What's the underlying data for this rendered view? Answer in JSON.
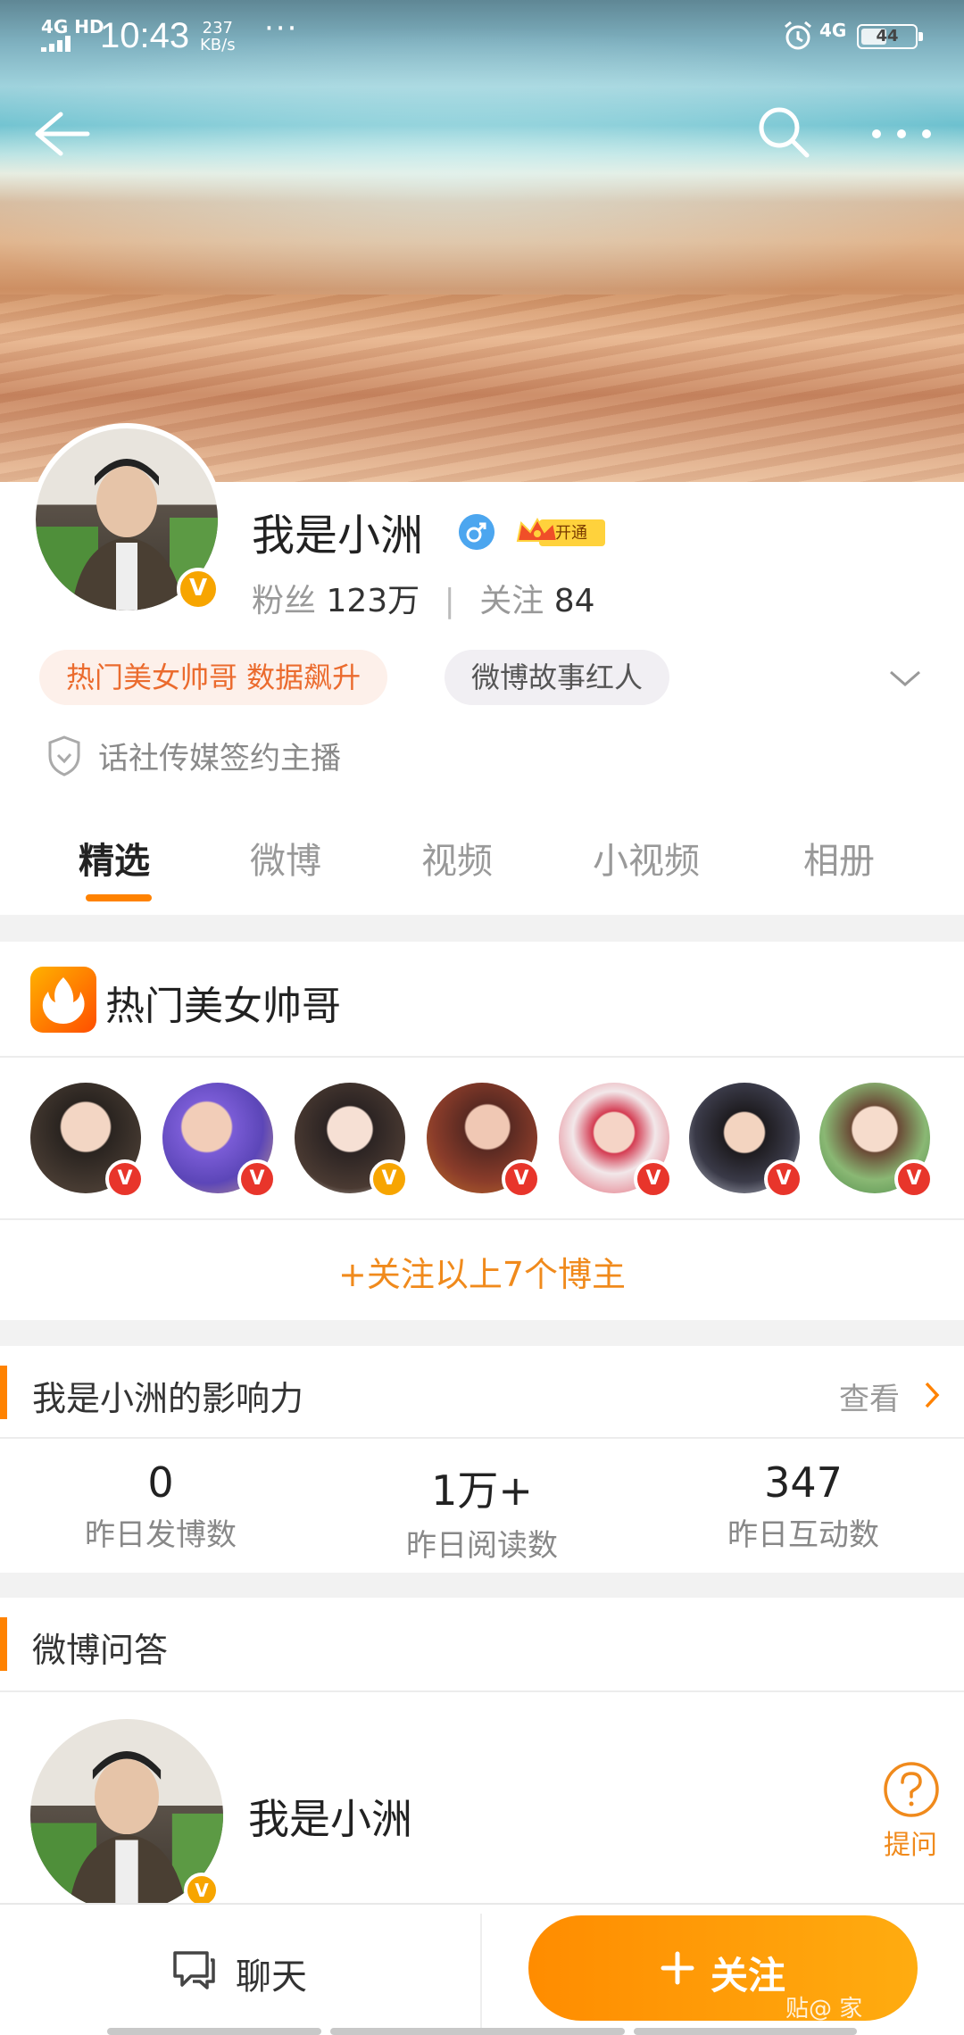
{
  "status_bar": {
    "network": "4G HD",
    "time": "10:43",
    "speed_value": "237",
    "speed_unit": "KB/s",
    "network_right": "4G",
    "battery": "44"
  },
  "profile": {
    "name": "我是小洲",
    "vip_label": "开通",
    "fans_label": "粉丝",
    "fans_count": "123万",
    "following_label": "关注",
    "following_count": "84",
    "tags": [
      "热门美女帅哥 数据飙升",
      "微博故事红人"
    ],
    "signed": "话社传媒签约主播"
  },
  "tabs": [
    "精选",
    "微博",
    "视频",
    "小视频",
    "相册"
  ],
  "hot_section": {
    "title": "热门美女帅哥",
    "follow_all": "+关注以上7个博主"
  },
  "influence": {
    "title": "我是小洲的影响力",
    "view": "查看",
    "stats": [
      {
        "value": "0",
        "label": "昨日发博数"
      },
      {
        "value": "1万+",
        "label": "昨日阅读数"
      },
      {
        "value": "347",
        "label": "昨日互动数"
      }
    ]
  },
  "qa": {
    "title": "微博问答",
    "name": "我是小洲",
    "ask": "提问"
  },
  "bottom_bar": {
    "chat": "聊天",
    "follow": "关注",
    "watermark": "贴@ 家"
  },
  "colors": {
    "accent": "#ff8200",
    "verified_orange": "#f7a500",
    "verified_red": "#e8352b"
  }
}
